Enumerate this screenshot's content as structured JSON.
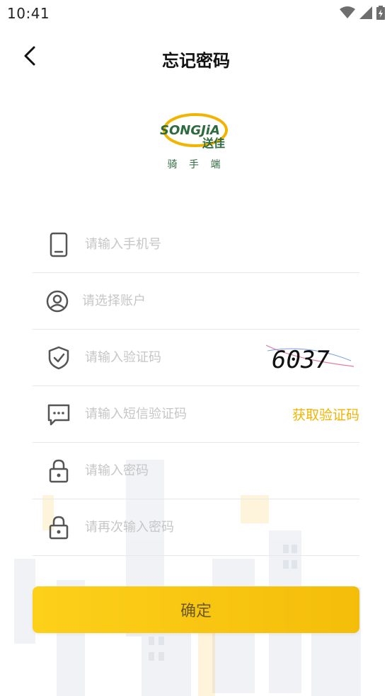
{
  "status_bar": {
    "time": "10:41"
  },
  "nav": {
    "title": "忘记密码"
  },
  "logo": {
    "brand": "SONGJiA",
    "brand_cn": "送佳",
    "subtitle": "骑 手 端"
  },
  "form": {
    "phone_placeholder": "请输入手机号",
    "account_placeholder": "请选择账户",
    "captcha_placeholder": "请输入验证码",
    "captcha_code": "6037",
    "sms_placeholder": "请输入短信验证码",
    "sms_button_label": "获取验证码",
    "password_placeholder": "请输入密码",
    "confirm_password_placeholder": "请再次输入密码"
  },
  "confirm_label": "确定",
  "colors": {
    "accent": "#f2b400",
    "button": "#fdd01a",
    "brand_green": "#2d6b3e"
  }
}
